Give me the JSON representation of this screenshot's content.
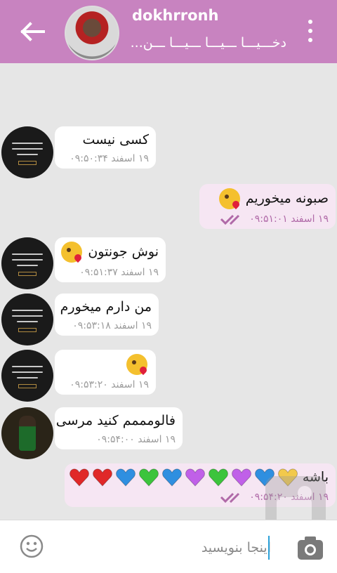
{
  "header": {
    "name": "dokhrronh",
    "status": "دخـــیـــا ـــیـــا ـــیـــا ـــن..."
  },
  "messages": [
    {
      "dir": "in",
      "text": "کسی نیست",
      "time": "۱۹ اسفند ۰۹:۵۰:۳۴"
    },
    {
      "dir": "out",
      "text": "صبونه میخوریم",
      "time": "۱۹ اسفند ۰۹:۵۱:۰۱"
    },
    {
      "dir": "in",
      "text": "نوش جونتون",
      "time": "۱۹ اسفند ۰۹:۵۱:۳۷"
    },
    {
      "dir": "in",
      "text": "من دارم میخورم",
      "time": "۱۹ اسفند ۰۹:۵۳:۱۸"
    },
    {
      "dir": "in",
      "text": "",
      "time": "۱۹ اسفند ۰۹:۵۳:۲۰"
    },
    {
      "dir": "in",
      "text": "فالومممم کنید مرسی",
      "time": "۱۹ اسفند ۰۹:۵۴:۰۰"
    },
    {
      "dir": "out",
      "text": "باشه",
      "time": "۱۹ اسفند ۰۹:۵۴:۲۰"
    }
  ],
  "heart_colors": [
    "#f2c94c",
    "#2f8fe0",
    "#c060e8",
    "#3cc43c",
    "#c060e8",
    "#2f8fe0",
    "#3cc43c",
    "#2f8fe0",
    "#e02828",
    "#e02828"
  ],
  "composer": {
    "placeholder": "اینجا بنویسید"
  },
  "colors": {
    "header": "#c883c0",
    "chat_bg": "#e6e6e6",
    "outgoing_bubble": "#f6e6f3",
    "tick": "#b06aa8"
  },
  "icons": {
    "back": "arrow-left-icon",
    "menu": "more-vertical-icon",
    "emoji": "smile-icon",
    "send": "camera-icon",
    "tick": "double-check-icon"
  }
}
